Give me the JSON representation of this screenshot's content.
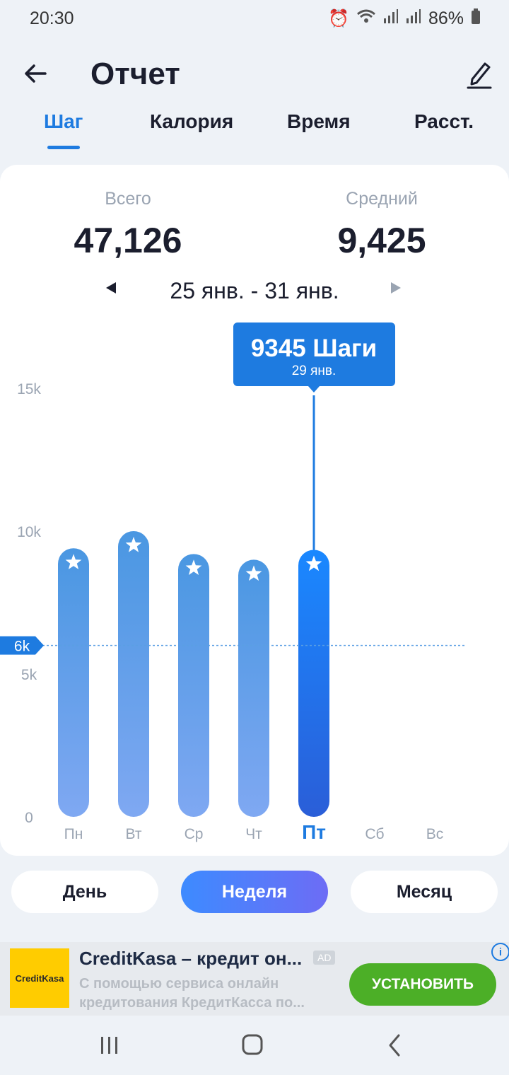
{
  "status": {
    "time": "20:30",
    "battery": "86%"
  },
  "appbar": {
    "title": "Отчет"
  },
  "tabs": [
    {
      "label": "Шаг",
      "active": true
    },
    {
      "label": "Калория",
      "active": false
    },
    {
      "label": "Время",
      "active": false
    },
    {
      "label": "Расст.",
      "active": false
    }
  ],
  "summary": {
    "total_label": "Всего",
    "total_value": "47,126",
    "avg_label": "Средний",
    "avg_value": "9,425"
  },
  "range": {
    "text": "25 янв. - 31 янв."
  },
  "chart_data": {
    "type": "bar",
    "categories": [
      "Пн",
      "Вт",
      "Ср",
      "Чт",
      "Пт",
      "Сб",
      "Вс"
    ],
    "values": [
      9400,
      10000,
      9200,
      9000,
      9345,
      null,
      null
    ],
    "selected_index": 4,
    "y_ticks": [
      "0",
      "5k",
      "10k",
      "15k"
    ],
    "ylim": [
      0,
      15000
    ],
    "goal": {
      "value": 6000,
      "label": "6k"
    },
    "tooltip": {
      "title": "9345 Шаги",
      "subtitle": "29 янв."
    },
    "grid": false,
    "bar_color": "#6fa3ec",
    "selected_color": "#1e7be0"
  },
  "period": {
    "day": "День",
    "week": "Неделя",
    "month": "Месяц"
  },
  "ad": {
    "logo_text": "CreditKasa",
    "title": "CreditKasa – кредит он...",
    "badge": "AD",
    "description": "С помощью сервиса онлайн кредитования КредитКасса по...",
    "cta": "УСТАНОВИТЬ"
  }
}
